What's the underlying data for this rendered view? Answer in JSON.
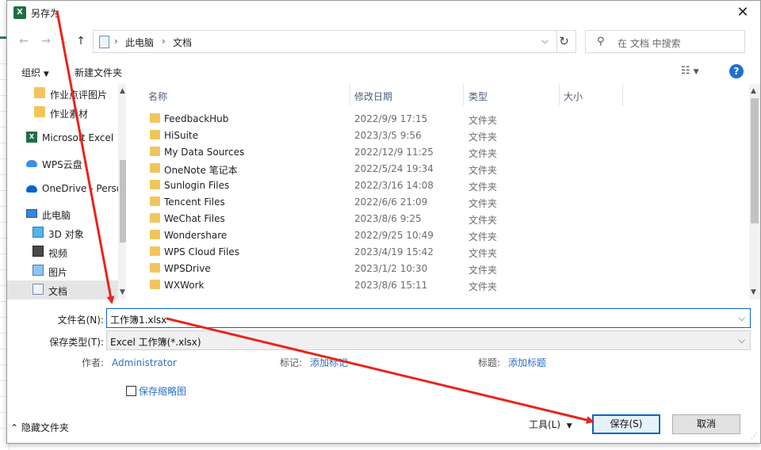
{
  "window": {
    "title": "另存为",
    "app_icon": "excel-icon",
    "close_glyph": "✕"
  },
  "nav": {
    "back": "←",
    "forward": "→",
    "recent": "⌄",
    "up": "↑",
    "breadcrumb": [
      "此电脑",
      "文档"
    ],
    "refresh": "↻",
    "search_placeholder": "在 文档 中搜索"
  },
  "toolbar": {
    "organize": "组织",
    "new_folder": "新建文件夹",
    "view_icon": "view-options-icon",
    "help": "?"
  },
  "sidebar": {
    "items": [
      {
        "label": "作业点评图片",
        "icon": "folder-icon"
      },
      {
        "label": "作业素材",
        "icon": "folder-icon"
      },
      {
        "label": "Microsoft Excel",
        "icon": "excel-icon"
      },
      {
        "label": "WPS云盘",
        "icon": "cloud-icon"
      },
      {
        "label": "OneDrive - Perso",
        "icon": "onedrive-icon"
      },
      {
        "label": "此电脑",
        "icon": "computer-icon"
      },
      {
        "label": "3D 对象",
        "icon": "cube-icon"
      },
      {
        "label": "视频",
        "icon": "video-icon"
      },
      {
        "label": "图片",
        "icon": "picture-icon"
      },
      {
        "label": "文档",
        "icon": "document-icon",
        "selected": true
      }
    ]
  },
  "columns": {
    "name": "名称",
    "date": "修改日期",
    "type": "类型",
    "size": "大小"
  },
  "files": [
    {
      "name": "FeedbackHub",
      "date": "2022/9/9 17:15",
      "type": "文件夹"
    },
    {
      "name": "HiSuite",
      "date": "2023/3/5 9:56",
      "type": "文件夹"
    },
    {
      "name": "My Data Sources",
      "date": "2022/12/9 11:25",
      "type": "文件夹"
    },
    {
      "name": "OneNote 笔记本",
      "date": "2022/5/24 19:34",
      "type": "文件夹"
    },
    {
      "name": "Sunlogin Files",
      "date": "2022/3/16 14:08",
      "type": "文件夹"
    },
    {
      "name": "Tencent Files",
      "date": "2022/6/6 21:09",
      "type": "文件夹"
    },
    {
      "name": "WeChat Files",
      "date": "2023/8/6 9:25",
      "type": "文件夹"
    },
    {
      "name": "Wondershare",
      "date": "2022/9/25 10:49",
      "type": "文件夹"
    },
    {
      "name": "WPS Cloud Files",
      "date": "2023/4/19 15:42",
      "type": "文件夹"
    },
    {
      "name": "WPSDrive",
      "date": "2023/1/2 10:30",
      "type": "文件夹"
    },
    {
      "name": "WXWork",
      "date": "2023/8/6 15:11",
      "type": "文件夹"
    }
  ],
  "form": {
    "filename_label": "文件名(N):",
    "filename_value": "工作簿1.xlsx",
    "filetype_label": "保存类型(T):",
    "filetype_value": "Excel 工作簿(*.xlsx)"
  },
  "meta": {
    "author_label": "作者:",
    "author_value": "Administrator",
    "tags_label": "标记:",
    "tags_value": "添加标记",
    "title_label": "标题:",
    "title_value": "添加标题"
  },
  "thumbnail_label": "保存缩略图",
  "footer": {
    "hide_folders": "隐藏文件夹",
    "tools": "工具(L)",
    "save": "保存(S)",
    "cancel": "取消"
  },
  "colors": {
    "accent": "#0a64c8",
    "link": "#2a6fc9",
    "annotation": "#e8251b",
    "folder": "#f2c55c",
    "excel": "#1d6f42"
  }
}
